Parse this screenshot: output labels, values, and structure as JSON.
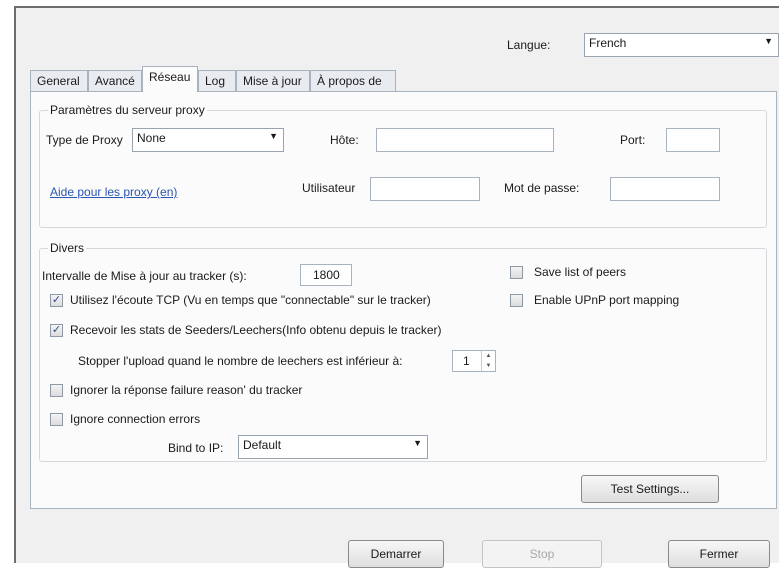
{
  "language": {
    "label": "Langue:",
    "value": "French"
  },
  "tabs": [
    {
      "label": "General"
    },
    {
      "label": "Avancé"
    },
    {
      "label": "Réseau"
    },
    {
      "label": "Log"
    },
    {
      "label": "Mise à jour"
    },
    {
      "label": "À propos de"
    }
  ],
  "active_tab": "Réseau",
  "proxy": {
    "group_title": "Paramètres du serveur proxy",
    "type_label": "Type de Proxy",
    "type_value": "None",
    "host_label": "Hôte:",
    "host_value": "",
    "port_label": "Port:",
    "port_value": "",
    "help_link": "Aide pour les proxy (en)",
    "user_label": "Utilisateur",
    "user_value": "",
    "password_label": "Mot de passe:",
    "password_value": ""
  },
  "divers": {
    "group_title": "Divers",
    "interval_label": "Intervalle de Mise à jour au tracker (s):",
    "interval_value": "1800",
    "tcp_label": "Utilisez l'écoute TCP (Vu en temps que \"connectable\" sur le tracker)",
    "tcp_checked": true,
    "stats_label": "Recevoir les stats de Seeders/Leechers(Info obtenu depuis le tracker)",
    "stats_checked": true,
    "stop_upload_label": "Stopper l'upload quand le nombre de leechers est inférieur à:",
    "stop_upload_value": "1",
    "ignore_failure_label": "Ignorer la réponse failure reason' du tracker",
    "ignore_failure_checked": false,
    "ignore_errors_label": "Ignore connection errors",
    "ignore_errors_checked": false,
    "bind_label": "Bind to IP:",
    "bind_value": "Default",
    "save_peers_label": "Save list of peers",
    "save_peers_checked": false,
    "upnp_label": "Enable UPnP port mapping",
    "upnp_checked": false
  },
  "buttons": {
    "test_settings": "Test Settings...",
    "start": "Demarrer",
    "stop": "Stop",
    "close": "Fermer"
  },
  "icons": {
    "dropdown": "chevron-down-icon",
    "check": "checkmark-icon",
    "spin": "spinner-arrows-icon"
  }
}
